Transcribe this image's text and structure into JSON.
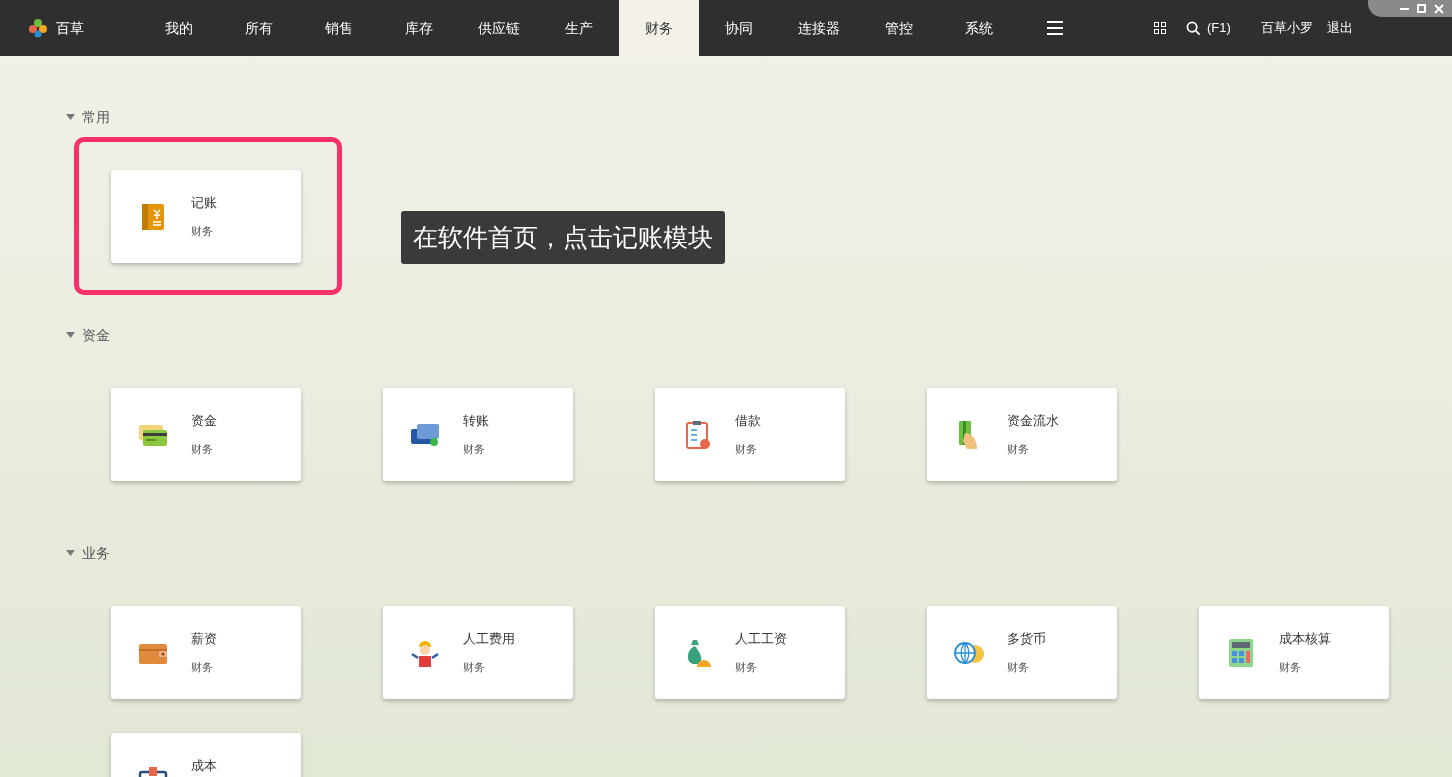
{
  "app": {
    "name": "百草"
  },
  "nav": [
    {
      "label": "我的",
      "selected": false
    },
    {
      "label": "所有",
      "selected": false
    },
    {
      "label": "销售",
      "selected": false
    },
    {
      "label": "库存",
      "selected": false
    },
    {
      "label": "供应链",
      "selected": false
    },
    {
      "label": "生产",
      "selected": false
    },
    {
      "label": "财务",
      "selected": true
    },
    {
      "label": "协同",
      "selected": false
    },
    {
      "label": "连接器",
      "selected": false
    },
    {
      "label": "管控",
      "selected": false
    },
    {
      "label": "系统",
      "selected": false
    }
  ],
  "toolbar": {
    "search_shortcut": "(F1)",
    "user": "百草小罗",
    "logout": "退出"
  },
  "sections": [
    {
      "title": "常用",
      "expanded": true,
      "cards": [
        {
          "kind": "notebook",
          "title": "记账",
          "subtitle": "财务",
          "highlighted": true
        }
      ]
    },
    {
      "title": "资金",
      "expanded": true,
      "cards": [
        {
          "kind": "card",
          "title": "资金",
          "subtitle": "财务",
          "highlighted": false
        },
        {
          "kind": "transfer",
          "title": "转账",
          "subtitle": "财务",
          "highlighted": false
        },
        {
          "kind": "clipboard",
          "title": "借款",
          "subtitle": "财务",
          "highlighted": false
        },
        {
          "kind": "handcard",
          "title": "资金流水",
          "subtitle": "财务",
          "highlighted": false
        }
      ]
    },
    {
      "title": "业务",
      "expanded": true,
      "cards": [
        {
          "kind": "wallet",
          "title": "薪资",
          "subtitle": "财务",
          "highlighted": false
        },
        {
          "kind": "worker",
          "title": "人工费用",
          "subtitle": "财务",
          "highlighted": false
        },
        {
          "kind": "moneybag",
          "title": "人工工资",
          "subtitle": "财务",
          "highlighted": false
        },
        {
          "kind": "globe",
          "title": "多货币",
          "subtitle": "财务",
          "highlighted": false
        },
        {
          "kind": "calculator",
          "title": "成本核算",
          "subtitle": "财务",
          "highlighted": false
        },
        {
          "kind": "box",
          "title": "成本",
          "highlighted": false
        }
      ]
    }
  ],
  "annotation": "在软件首页，点击记账模块"
}
